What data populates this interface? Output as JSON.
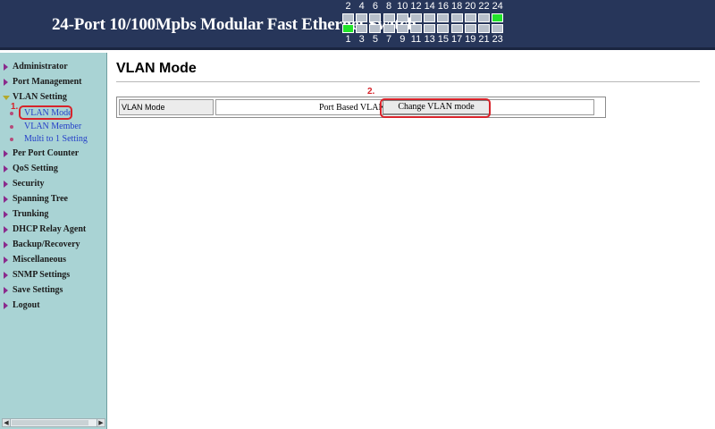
{
  "header": {
    "title": "24-Port 10/100Mpbs Modular Fast Ethernet Switch",
    "ports_top": [
      {
        "num": "2",
        "up": false
      },
      {
        "num": "4",
        "up": false
      },
      {
        "num": "6",
        "up": false
      },
      {
        "num": "8",
        "up": false
      },
      {
        "num": "10",
        "up": false
      },
      {
        "num": "12",
        "up": false
      },
      {
        "num": "14",
        "up": false
      },
      {
        "num": "16",
        "up": false
      },
      {
        "num": "18",
        "up": false
      },
      {
        "num": "20",
        "up": false
      },
      {
        "num": "22",
        "up": false
      },
      {
        "num": "24",
        "up": true
      }
    ],
    "ports_bottom": [
      {
        "num": "1",
        "up": true
      },
      {
        "num": "3",
        "up": false
      },
      {
        "num": "5",
        "up": false
      },
      {
        "num": "7",
        "up": false
      },
      {
        "num": "9",
        "up": false
      },
      {
        "num": "11",
        "up": false
      },
      {
        "num": "13",
        "up": false
      },
      {
        "num": "15",
        "up": false
      },
      {
        "num": "17",
        "up": false
      },
      {
        "num": "19",
        "up": false
      },
      {
        "num": "21",
        "up": false
      },
      {
        "num": "23",
        "up": false
      }
    ]
  },
  "sidebar": {
    "items": [
      {
        "label": "Administrator"
      },
      {
        "label": "Port Management"
      },
      {
        "label": "VLAN Setting",
        "open": true,
        "children": [
          {
            "label": "VLAN Mode",
            "active": true
          },
          {
            "label": "VLAN Member"
          },
          {
            "label": "Multi to 1 Setting"
          }
        ]
      },
      {
        "label": "Per Port Counter"
      },
      {
        "label": "QoS Setting"
      },
      {
        "label": "Security"
      },
      {
        "label": "Spanning Tree"
      },
      {
        "label": "Trunking"
      },
      {
        "label": "DHCP Relay Agent"
      },
      {
        "label": "Backup/Recovery"
      },
      {
        "label": "Miscellaneous"
      },
      {
        "label": "SNMP Settings"
      },
      {
        "label": "Save Settings"
      },
      {
        "label": "Logout"
      }
    ],
    "step1_marker": "1."
  },
  "main": {
    "page_title": "VLAN Mode",
    "row_label": "VLAN Mode",
    "current_mode": "Port Based VLAN",
    "change_button_label": "Change VLAN mode",
    "step2_marker": "2."
  },
  "colors": {
    "header_bg": "#27365a",
    "sidebar_bg": "#a9d3d4",
    "link_up": "#22e32a",
    "annotation_red": "#d7232a"
  }
}
